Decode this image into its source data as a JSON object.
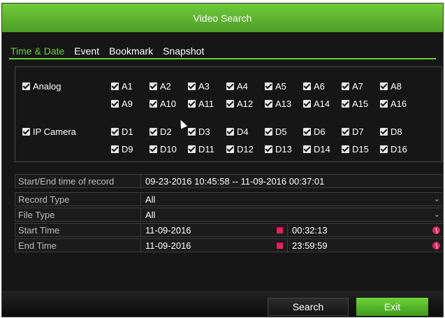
{
  "window": {
    "title": "Video Search"
  },
  "tabs": [
    {
      "label": "Time & Date"
    },
    {
      "label": "Event"
    },
    {
      "label": "Bookmark"
    },
    {
      "label": "Snapshot"
    }
  ],
  "channels": {
    "analog_label": "Analog",
    "ip_camera_label": "IP Camera",
    "analog_row1": [
      "A1",
      "A2",
      "A3",
      "A4",
      "A5",
      "A6",
      "A7",
      "A8"
    ],
    "analog_row2": [
      "A9",
      "A10",
      "A11",
      "A12",
      "A13",
      "A14",
      "A15",
      "A16"
    ],
    "ip_row1": [
      "D1",
      "D2",
      "D3",
      "D4",
      "D5",
      "D6",
      "D7",
      "D8"
    ],
    "ip_row2": [
      "D9",
      "D10",
      "D11",
      "D12",
      "D13",
      "D14",
      "D15",
      "D16"
    ]
  },
  "form": {
    "record_range_label": "Start/End time of record",
    "record_range_value": "09-23-2016 10:45:58 -- 11-09-2016 00:37:01",
    "record_type_label": "Record Type",
    "record_type_value": "All",
    "file_type_label": "File Type",
    "file_type_value": "All",
    "start_time_label": "Start Time",
    "start_date": "11-09-2016",
    "start_clock": "00:32:13",
    "end_time_label": "End Time",
    "end_date": "11-09-2016",
    "end_clock": "23:59:59"
  },
  "buttons": {
    "search": "Search",
    "exit": "Exit"
  },
  "colors": {
    "accent": "#6fcb3a",
    "background": "#161616",
    "icon": "#e0245e"
  }
}
